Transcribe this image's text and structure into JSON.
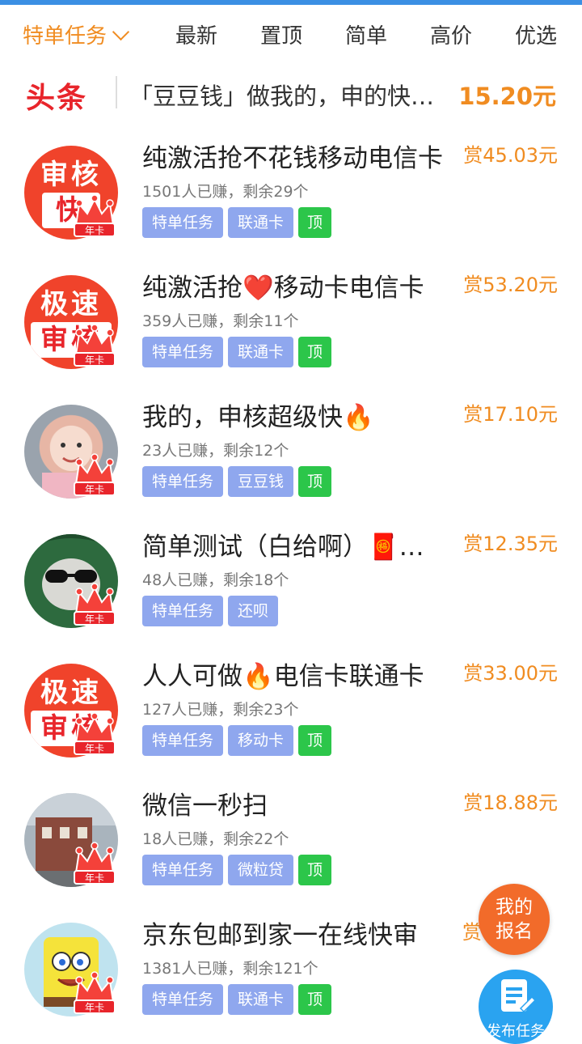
{
  "tabs": [
    {
      "label": "特单任务",
      "active": true
    },
    {
      "label": "最新"
    },
    {
      "label": "置顶"
    },
    {
      "label": "简单"
    },
    {
      "label": "高价"
    },
    {
      "label": "优选"
    }
  ],
  "headline": {
    "badge": "头条",
    "text": "「豆豆钱」做我的，申的快…",
    "reward": "15.20元"
  },
  "tasks": [
    {
      "title": "纯激活抢不花钱移动电信卡",
      "reward": "赏45.03元",
      "stats": "1501人已赚，剩余29个",
      "avatar_text": [
        "审核",
        "快"
      ],
      "tags": [
        "特单任务",
        "联通卡"
      ],
      "top_label": "顶"
    },
    {
      "title": "纯激活抢❤️移动卡电信卡",
      "reward": "赏53.20元",
      "stats": "359人已赚，剩余11个",
      "avatar_text": [
        "极速",
        "审核"
      ],
      "tags": [
        "特单任务",
        "联通卡"
      ],
      "top_label": "顶"
    },
    {
      "title": "我的，申核超级快🔥",
      "reward": "赏17.10元",
      "stats": "23人已赚，剩余12个",
      "tags": [
        "特单任务",
        "豆豆钱"
      ],
      "top_label": "顶"
    },
    {
      "title": "简单测试（白给啊）🧧…",
      "reward": "赏12.35元",
      "stats": "48人已赚，剩余18个",
      "tags": [
        "特单任务",
        "还呗"
      ]
    },
    {
      "title": "人人可做🔥电信卡联通卡",
      "reward": "赏33.00元",
      "stats": "127人已赚，剩余23个",
      "avatar_text": [
        "极速",
        "审核"
      ],
      "tags": [
        "特单任务",
        "移动卡"
      ],
      "top_label": "顶"
    },
    {
      "title": "微信一秒扫",
      "reward": "赏18.88元",
      "stats": "18人已赚，剩余22个",
      "tags": [
        "特单任务",
        "微粒贷"
      ],
      "top_label": "顶"
    },
    {
      "title": "京东包邮到家一在线快审",
      "reward": "赏",
      "stats": "1381人已赚，剩余121个",
      "tags": [
        "特单任务",
        "联通卡"
      ],
      "top_label": "顶"
    }
  ],
  "crown_label": "年卡",
  "fab": {
    "my_signup": [
      "我的",
      "报名"
    ],
    "publish": "发布任务"
  },
  "colors": {
    "accent": "#f08c21",
    "tag": "#8fa7ee",
    "top_tag": "#2cc64a",
    "headline_red": "#e8252b"
  }
}
